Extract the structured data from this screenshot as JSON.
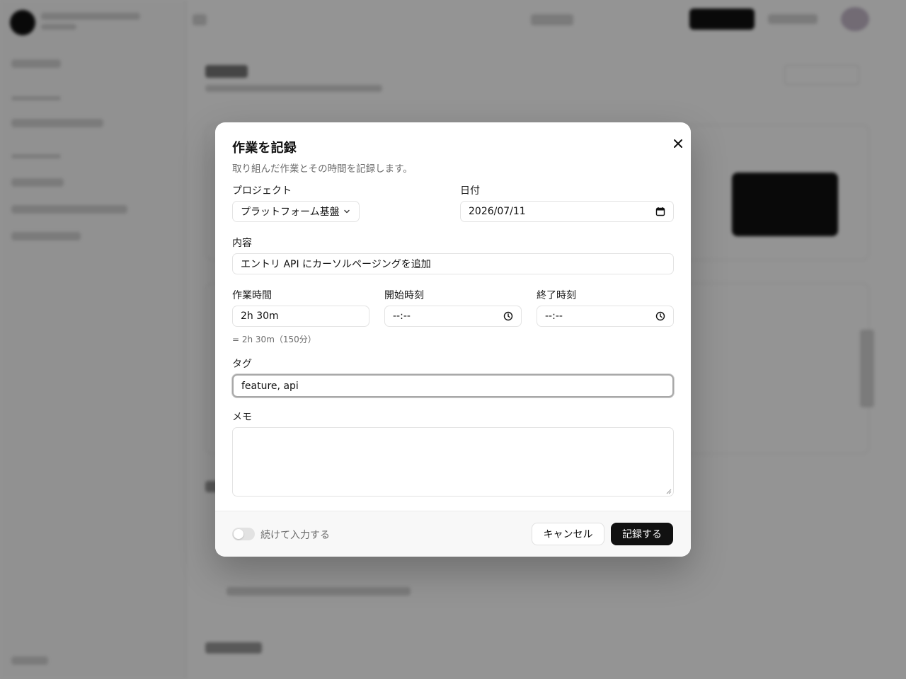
{
  "dialog": {
    "title": "作業を記録",
    "subtitle": "取り組んだ作業とその時間を記録します。",
    "fields": {
      "project": {
        "label": "プロジェクト",
        "value": "プラットフォーム基盤"
      },
      "date": {
        "label": "日付",
        "value": "2026/07/11"
      },
      "content": {
        "label": "内容",
        "value": "エントリ API にカーソルページングを追加"
      },
      "duration": {
        "label": "作業時間",
        "value": "2h 30m",
        "hint": "= 2h 30m（150分）"
      },
      "start_time": {
        "label": "開始時刻",
        "value": "--:--"
      },
      "end_time": {
        "label": "終了時刻",
        "value": "--:--"
      },
      "tags": {
        "label": "タグ",
        "value": "feature, api"
      },
      "memo": {
        "label": "メモ",
        "value": ""
      }
    },
    "footer": {
      "continue_toggle_label": "続けて入力する",
      "continue_toggle_on": false,
      "cancel_label": "キャンセル",
      "submit_label": "記録する"
    }
  },
  "icons": {
    "close": "close-icon",
    "chevron": "chevron-down-icon",
    "calendar": "calendar-icon",
    "clock": "clock-icon"
  }
}
